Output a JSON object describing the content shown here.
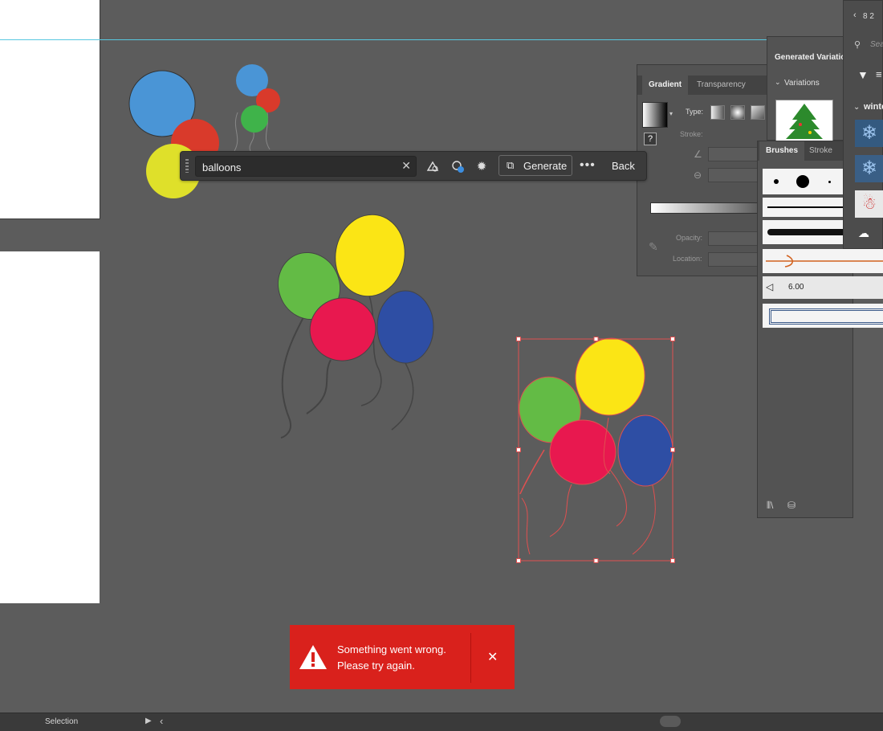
{
  "search": {
    "value": "balloons"
  },
  "taskbar": {
    "generate_label": "Generate",
    "back_label": "Back"
  },
  "gradient_panel": {
    "tabs": [
      "Gradient",
      "Transparency"
    ],
    "type_label": "Type:",
    "stroke_label": "Stroke:",
    "opacity_label": "Opacity:",
    "location_label": "Location:"
  },
  "variations_panel": {
    "title": "Generated Variatio",
    "section_label": "Variations"
  },
  "brushes_panel": {
    "tabs": [
      "Brushes",
      "Stroke"
    ],
    "size_value": "6.00"
  },
  "right_panel": {
    "page_label": "8 2",
    "search_placeholder": "Sea",
    "section_label": "winte"
  },
  "status": {
    "tool": "Selection"
  },
  "error_toast": {
    "line1": "Something went wrong.",
    "line2": "Please try again."
  },
  "colors": {
    "canvas": "#5c5c5c",
    "error": "#d9211c",
    "selection": "#e05050",
    "guide": "#58c8e0"
  }
}
